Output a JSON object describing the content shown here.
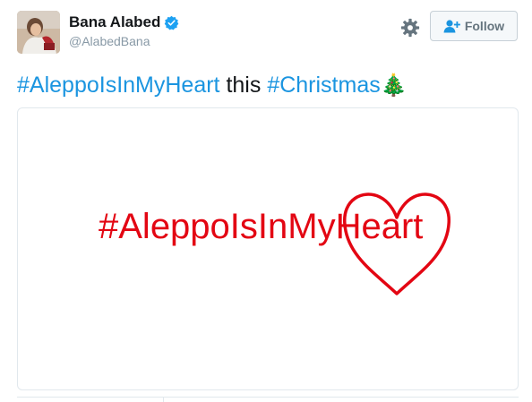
{
  "author": {
    "name": "Bana Alabed",
    "handle": "@AlabedBana",
    "verified": true,
    "avatar_icon": "user-avatar-photo"
  },
  "actions": {
    "settings_icon": "gear-icon",
    "follow_label": "Follow",
    "follow_icon": "add-user-icon"
  },
  "tweet": {
    "hashtag_1": "#AleppoIsInMyHeart",
    "word": " this ",
    "hashtag_2": "#Christmas",
    "emoji": "🎄"
  },
  "media": {
    "text": "#AleppoIsInMyHeart",
    "color": "#e30613"
  },
  "colors": {
    "link": "#1b95e0",
    "verified": "#1da1f2",
    "muted": "#8899a6"
  }
}
